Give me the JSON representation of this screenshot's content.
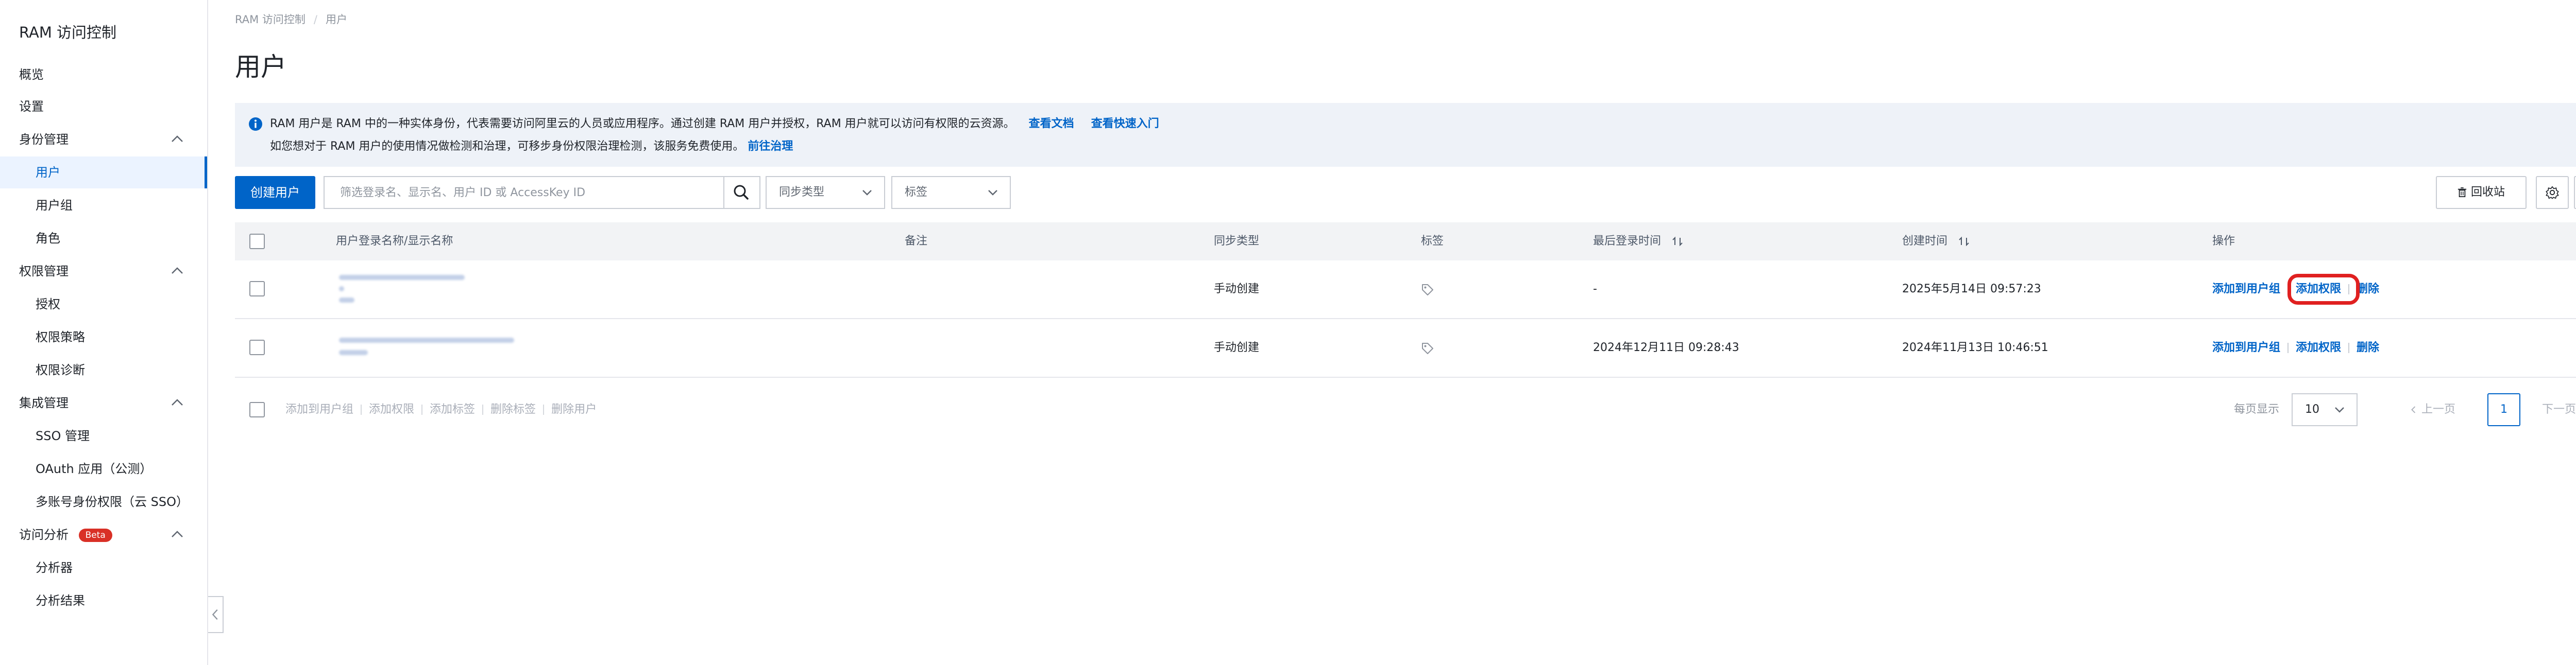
{
  "sidebar": {
    "title": "RAM 访问控制",
    "items": [
      {
        "label": "概览",
        "level": "top"
      },
      {
        "label": "设置",
        "level": "top"
      },
      {
        "label": "身份管理",
        "level": "group"
      },
      {
        "label": "用户",
        "level": "sub",
        "active": true
      },
      {
        "label": "用户组",
        "level": "sub"
      },
      {
        "label": "角色",
        "level": "sub"
      },
      {
        "label": "权限管理",
        "level": "group"
      },
      {
        "label": "授权",
        "level": "sub"
      },
      {
        "label": "权限策略",
        "level": "sub"
      },
      {
        "label": "权限诊断",
        "level": "sub"
      },
      {
        "label": "集成管理",
        "level": "group"
      },
      {
        "label": "SSO 管理",
        "level": "sub"
      },
      {
        "label": "OAuth 应用（公测）",
        "level": "sub"
      },
      {
        "label": "多账号身份权限（云 SSO）",
        "level": "sub"
      },
      {
        "label": "访问分析",
        "level": "group",
        "badge": "Beta"
      },
      {
        "label": "分析器",
        "level": "sub"
      },
      {
        "label": "分析结果",
        "level": "sub"
      }
    ]
  },
  "breadcrumb": {
    "root": "RAM 访问控制",
    "separator": "/",
    "current": "用户"
  },
  "page": {
    "title": "用户"
  },
  "banner": {
    "line1_text": "RAM 用户是 RAM 中的一种实体身份，代表需要访问阿里云的人员或应用程序。通过创建 RAM 用户并授权，RAM 用户就可以访问有权限的云资源。",
    "link_docs": "查看文档",
    "link_quickstart": "查看快速入门",
    "line2_text": "如您想对于 RAM 用户的使用情况做检测和治理，可移步身份权限治理检测，该服务免费使用。",
    "link_govern": "前往治理"
  },
  "toolbar": {
    "create_button": "创建用户",
    "search_placeholder": "筛选登录名、显示名、用户 ID 或 AccessKey ID",
    "sync_type_select": "同步类型",
    "tag_select": "标签",
    "recycle_button": "回收站"
  },
  "table": {
    "columns": {
      "name": "用户登录名称/显示名称",
      "note": "备注",
      "sync_type": "同步类型",
      "tags": "标签",
      "last_login": "最后登录时间",
      "created": "创建时间",
      "actions": "操作"
    },
    "rows": [
      {
        "name_redacted": true,
        "note": "",
        "sync_type": "手动创建",
        "last_login": "-",
        "created": "2025年5月14日 09:57:23",
        "highlight_action": "add_permission"
      },
      {
        "name_redacted": true,
        "note": "",
        "sync_type": "手动创建",
        "last_login": "2024年12月11日 09:28:43",
        "created": "2024年11月13日 10:46:51"
      }
    ],
    "actions": {
      "add_to_group": "添加到用户组",
      "add_permission": "添加权限",
      "delete": "删除"
    }
  },
  "footer": {
    "bulk_actions": [
      "添加到用户组",
      "添加权限",
      "添加标签",
      "删除标签",
      "删除用户"
    ],
    "page_size_label": "每页显示",
    "page_size_value": "10",
    "prev": "上一页",
    "next": "下一页",
    "current_page": "1"
  },
  "colors": {
    "primary": "#0064c8",
    "highlight": "#e02020",
    "beta_badge": "#d93026",
    "banner_bg": "#eef2f8"
  }
}
